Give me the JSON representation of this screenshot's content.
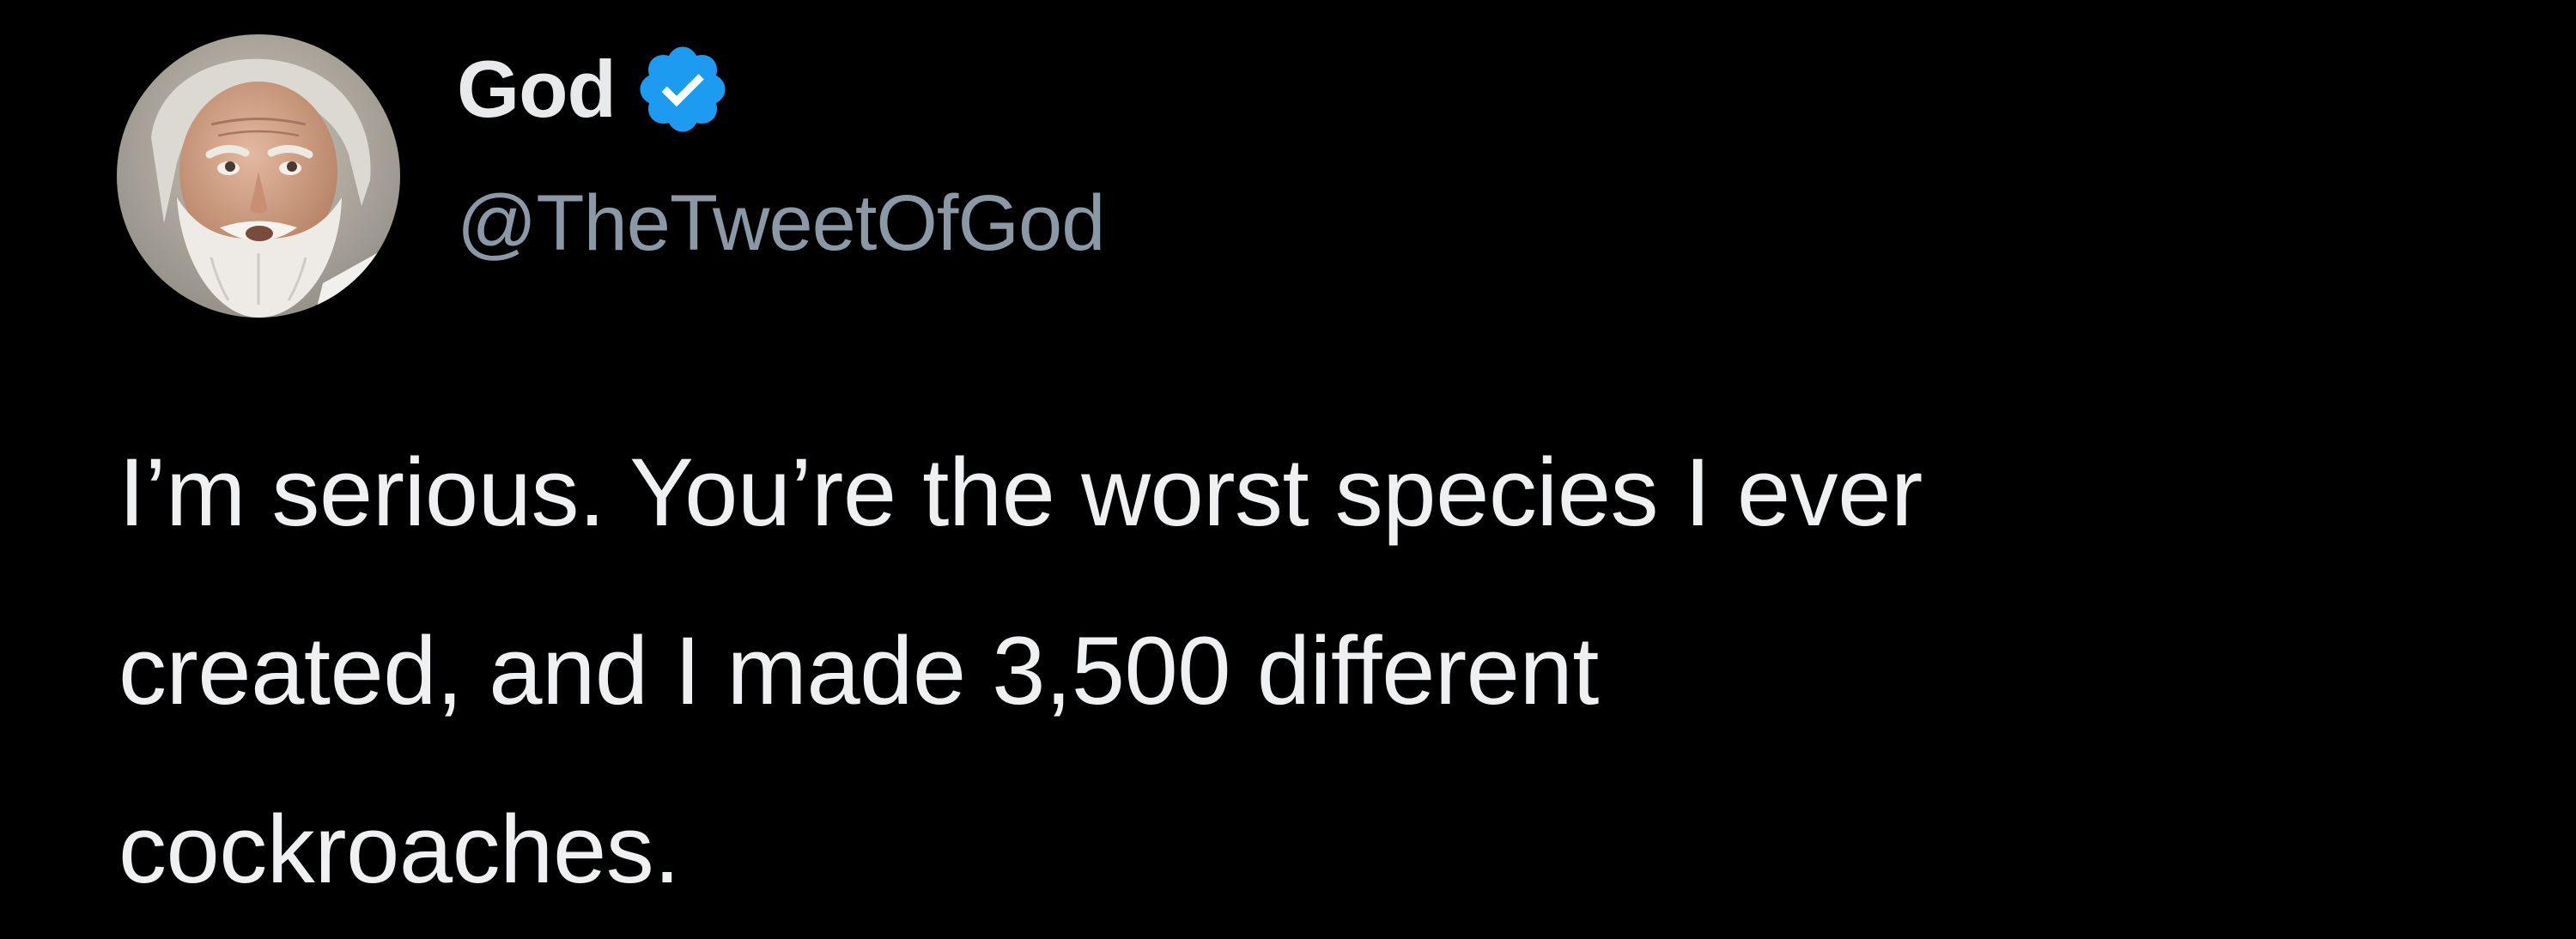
{
  "author": {
    "display_name": "God",
    "handle": "@TheTweetOfGod",
    "verified": true,
    "avatar_icon": "bearded-man-avatar",
    "verified_icon": "verified-badge-icon"
  },
  "tweet": {
    "lines": [
      "I’m serious. You’re the worst species I ever",
      "created, and I made 3,500 different",
      "cockroaches."
    ]
  },
  "colors": {
    "background": "#000000",
    "display_name": "#e7e9ea",
    "handle": "#8b98a5",
    "body_text": "#eef0f1",
    "verified_badge": "#1d9bf0"
  }
}
